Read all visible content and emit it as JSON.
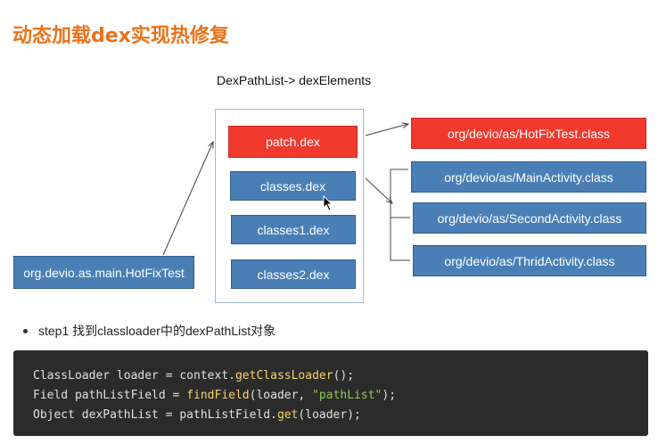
{
  "title": "动态加载dex实现热修复",
  "diagram": {
    "caption": "DexPathList->  dexElements",
    "source_box": "org.devio.as.main.HotFixTest",
    "dex_items": [
      "patch.dex",
      "classes.dex",
      "classes1.dex",
      "classes2.dex"
    ],
    "class_items": [
      "org/devio/as/HotFixTest.class",
      "org/devio/as/MainActivity.class",
      "org/devio/as/SecondActivity.class",
      "org/devio/as/ThridActivity.class"
    ],
    "colors": {
      "highlight": "#f03a2e",
      "normal": "#4a7fb5",
      "title": "#e8731a"
    }
  },
  "step": {
    "text": "step1 找到classloader中的dexPathList对象"
  },
  "code": {
    "line1": {
      "a": "ClassLoader loader = context.",
      "fn": "getClassLoader",
      "b": "();"
    },
    "line2": {
      "a": "Field pathListField = ",
      "fn": "findField",
      "b": "(loader, ",
      "str": "\"pathList\"",
      "c": ");"
    },
    "line3": {
      "a": "Object dexPathList = pathListField.",
      "fn": "get",
      "b": "(loader);"
    }
  }
}
